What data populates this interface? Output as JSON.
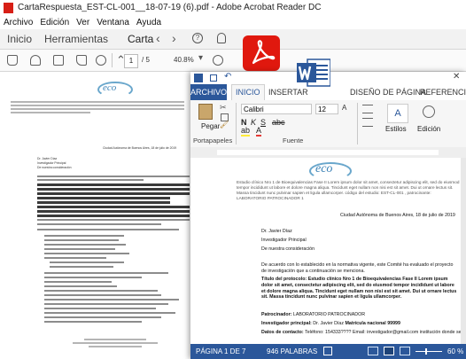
{
  "acrobat": {
    "window_title": "CartaRespuesta_EST-CL-001__18-07-19 (6).pdf - Adobe Acrobat Reader DC",
    "menu": [
      "Archivo",
      "Edición",
      "Ver",
      "Ventana",
      "Ayuda"
    ],
    "tabs": [
      "Inicio",
      "Herramientas",
      "Carta"
    ],
    "page_current": "1",
    "page_total": "/ 5",
    "zoom": "40.8%",
    "doc": {
      "logo": "eco",
      "city_date": "Ciudad Autónoma de Buenos Aires, 18 de julio de 2019",
      "salutation": [
        "Dr. Javier Díaz",
        "Investigador Principal",
        "De nuestra consideración"
      ]
    }
  },
  "word": {
    "tabs": [
      "ARCHIVO",
      "INICIO",
      "INSERTAR",
      "DISEÑO DE PÁGINA",
      "REFERENCIAS"
    ],
    "font_name": "Calibri",
    "font_size": "12",
    "paste_label": "Pegar",
    "edit_label": "Edición",
    "styles_label": "Estilos",
    "group_clipboard": "Portapapeles",
    "group_font": "Fuente",
    "logo": "eco",
    "header_text": "Estudio clínico Nro 1 de Bioequivalencias Fase II Lorem ipsum dolor sit amet, consectetur adipiscing elit, sed do eiusmod tempor incididunt ut labore et dolore magna aliqua. Tincidunt eget nullam non nisi est sit amet. Dui ut ornare lectus sit. Massa tincidunt nunc pulvinar sapien et ligula ullamcorper. código del estudio: EST-CL-001 , patrocinante: LABORATORIO PATROCINADOR 1",
    "city_date": "Ciudad Autónoma de Buenos Aires, 18 de julio de 2019",
    "addressee": [
      "Dr. Javier Díaz",
      "Investigador Principal",
      "De nuestra consideración"
    ],
    "body_intro": "De acuerdo con lo establecido en la normativa vigente, este Comité ha evaluado el proyecto de investigación que a continuación se menciona.",
    "protocol_title_label": "Título del protocolo:",
    "protocol_title": "Estudio clínico Nro 1 de Bioequivalencias Fase II Lorem ipsum dolor sit amet, consectetur adipiscing elit, sed do eiusmod tempor incididunt ut labore et dolore magna aliqua. Tincidunt eget nullam non nisi est sit amet. Dui ut ornare lectus sit. Massa tincidunt nunc pulvinar sapien et ligula ullamcorper.",
    "sponsor_label": "Patrocinador:",
    "sponsor": "LABORATORIO PATROCINADOR",
    "pi_label": "Investigador principal:",
    "pi": "Dr. Javier Díaz",
    "pi_registration": "Matrícula nacional 99999",
    "contact_label": "Datos de contacto:",
    "contact": "Teléfono: 154333???? Email: investigador@gmail.com institución donde se",
    "status": {
      "page": "PÁGINA 1 DE 7",
      "words": "946 PALABRAS",
      "zoom": "60 %"
    }
  }
}
